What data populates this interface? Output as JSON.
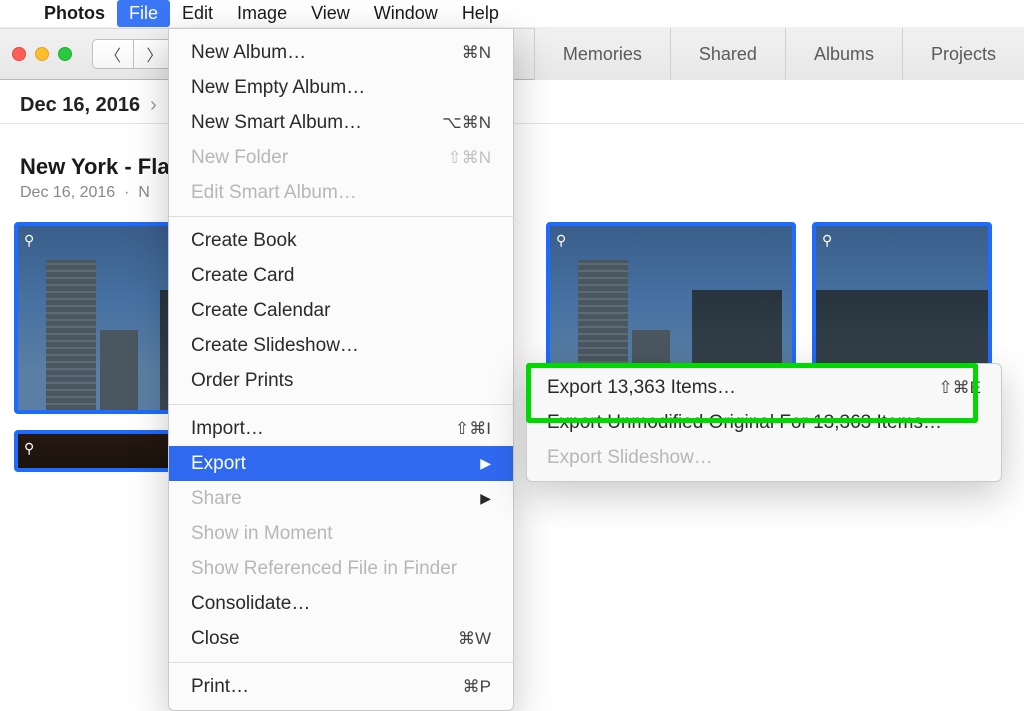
{
  "menubar": {
    "app": "Photos",
    "items": [
      "File",
      "Edit",
      "Image",
      "View",
      "Window",
      "Help"
    ],
    "active": "File"
  },
  "toolbar": {
    "tabs": [
      "Memories",
      "Shared",
      "Albums",
      "Projects"
    ]
  },
  "crumb": {
    "date": "Dec 16, 2016"
  },
  "section": {
    "title": "New York - Flati",
    "date": "Dec 16, 2016",
    "loc_abbrev": "N"
  },
  "file_menu": {
    "group1": [
      {
        "label": "New Album…",
        "sc": "⌘N"
      },
      {
        "label": "New Empty Album…",
        "sc": ""
      },
      {
        "label": "New Smart Album…",
        "sc": "⌥⌘N"
      },
      {
        "label": "New Folder",
        "sc": "⇧⌘N",
        "disabled": true
      },
      {
        "label": "Edit Smart Album…",
        "sc": "",
        "disabled": true
      }
    ],
    "group2": [
      {
        "label": "Create Book",
        "sc": ""
      },
      {
        "label": "Create Card",
        "sc": ""
      },
      {
        "label": "Create Calendar",
        "sc": ""
      },
      {
        "label": "Create Slideshow…",
        "sc": ""
      },
      {
        "label": "Order Prints",
        "sc": ""
      }
    ],
    "group3": [
      {
        "label": "Import…",
        "sc": "⇧⌘I"
      },
      {
        "label": "Export",
        "sc": "",
        "submenu": true,
        "selected": true
      },
      {
        "label": "Share",
        "sc": "",
        "submenu": true,
        "disabled": true
      },
      {
        "label": "Show in Moment",
        "sc": "",
        "disabled": true
      },
      {
        "label": "Show Referenced File in Finder",
        "sc": "",
        "disabled": true
      },
      {
        "label": "Consolidate…",
        "sc": ""
      },
      {
        "label": "Close",
        "sc": "⌘W"
      }
    ],
    "group4": [
      {
        "label": "Print…",
        "sc": "⌘P"
      }
    ]
  },
  "export_submenu": [
    {
      "label": "Export 13,363 Items…",
      "sc": "⇧⌘E"
    },
    {
      "label": "Export Unmodified Original For 13,363 Items…",
      "sc": ""
    },
    {
      "label": "Export Slideshow…",
      "sc": "",
      "disabled": true
    }
  ]
}
